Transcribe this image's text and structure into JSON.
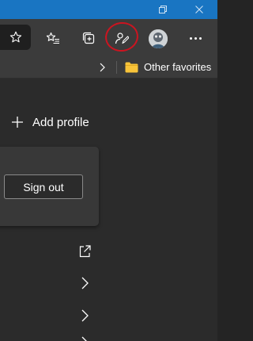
{
  "titlebar": {
    "background": "#1975c2",
    "buttons": [
      {
        "icon": "restore-icon"
      },
      {
        "icon": "close-icon"
      }
    ]
  },
  "toolbar": {
    "buttons": [
      {
        "icon": "star-icon"
      },
      {
        "icon": "favorites-list-icon"
      },
      {
        "icon": "collections-icon"
      },
      {
        "icon": "feedback-icon"
      },
      {
        "icon": "profile-avatar"
      },
      {
        "icon": "more-menu-icon"
      }
    ],
    "annotation_color": "#cc1420"
  },
  "favorites_bar": {
    "other_favorites_label": "Other favorites",
    "folder_color": "#f8c43a"
  },
  "panel": {
    "add_profile_label": "Add profile",
    "sign_out_label": "Sign out",
    "rows": [
      {
        "icon": "open-external-icon"
      },
      {
        "icon": "chevron-right-icon"
      },
      {
        "icon": "chevron-right-icon"
      },
      {
        "icon": "chevron-right-icon"
      }
    ]
  }
}
